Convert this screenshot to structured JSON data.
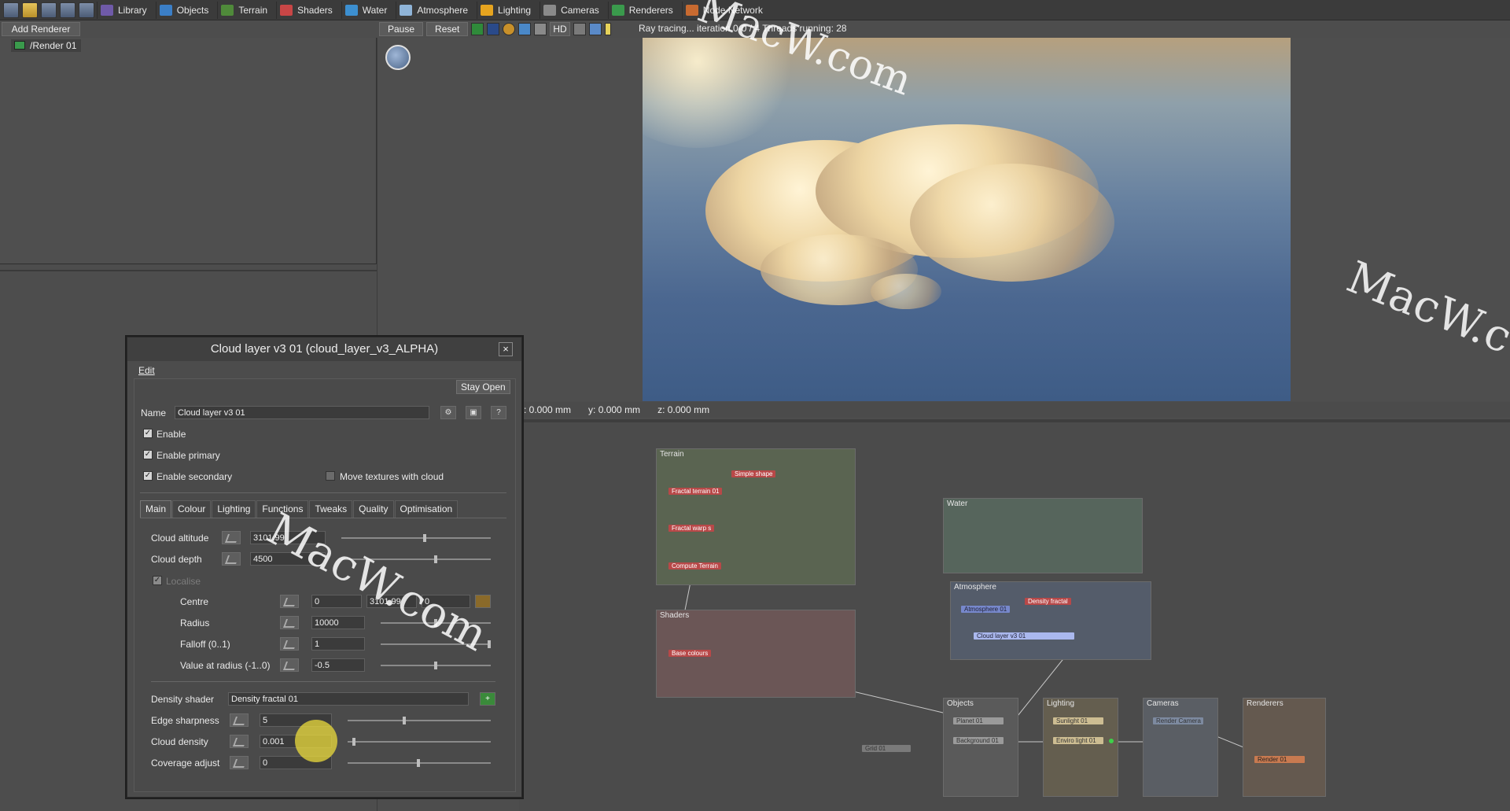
{
  "toolbar": {
    "items": [
      {
        "label": "Library",
        "icon": "library-icon",
        "color": "#6f5aa8"
      },
      {
        "label": "Objects",
        "icon": "objects-icon",
        "color": "#3b7fc7"
      },
      {
        "label": "Terrain",
        "icon": "terrain-icon",
        "color": "#4f8a3a"
      },
      {
        "label": "Shaders",
        "icon": "shaders-icon",
        "color": "#c84646"
      },
      {
        "label": "Water",
        "icon": "water-icon",
        "color": "#3c8fd0"
      },
      {
        "label": "Atmosphere",
        "icon": "atmosphere-icon",
        "color": "#8fb4d8"
      },
      {
        "label": "Lighting",
        "icon": "lighting-icon",
        "color": "#e6a41f"
      },
      {
        "label": "Cameras",
        "icon": "cameras-icon",
        "color": "#8a8a8a"
      },
      {
        "label": "Renderers",
        "icon": "renderers-icon",
        "color": "#3a9a4c"
      },
      {
        "label": "Node Network",
        "icon": "node-network-icon",
        "color": "#c86a30"
      }
    ]
  },
  "renderers": {
    "add_label": "Add Renderer",
    "item_label": "/Render 01"
  },
  "render_controls": {
    "pause_label": "Pause",
    "reset_label": "Reset",
    "hd_label": "HD",
    "status": "Ray tracing... iteration 0-0 / 4     Threads running: 28"
  },
  "coords": {
    "x": "x: 0.000 mm",
    "y": "y: 0.000 mm",
    "z": "z: 0.000 mm"
  },
  "dialog": {
    "title": "Cloud layer v3 01    (cloud_layer_v3_ALPHA)",
    "close": "×",
    "menu_edit": "Edit",
    "stay_open": "Stay Open",
    "name_label": "Name",
    "name_value": "Cloud layer v3 01",
    "enable": "Enable",
    "enable_primary": "Enable primary",
    "enable_secondary": "Enable secondary",
    "move_textures": "Move textures with cloud",
    "tabs": [
      "Main",
      "Colour",
      "Lighting",
      "Functions",
      "Tweaks",
      "Quality",
      "Optimisation"
    ],
    "cloud_altitude_label": "Cloud altitude",
    "cloud_altitude": "3101.99",
    "cloud_depth_label": "Cloud depth",
    "cloud_depth": "4500",
    "localise": "Localise",
    "centre_label": "Centre",
    "centre_x": "0",
    "centre_y": "3101.99",
    "centre_z": "0",
    "radius_label": "Radius",
    "radius": "10000",
    "falloff_label": "Falloff (0..1)",
    "falloff": "1",
    "value_at_radius_label": "Value at radius (-1..0)",
    "value_at_radius": "-0.5",
    "density_shader_label": "Density shader",
    "density_shader": "Density fractal 01",
    "edge_sharpness_label": "Edge sharpness",
    "edge_sharpness": "5",
    "cloud_density_label": "Cloud density",
    "cloud_density": "0.001",
    "coverage_adjust_label": "Coverage adjust",
    "coverage_adjust": "0"
  },
  "node_network": {
    "groups": {
      "terrain": "Terrain",
      "shaders": "Shaders",
      "water": "Water",
      "atmosphere": "Atmosphere",
      "objects": "Objects",
      "lighting": "Lighting",
      "cameras": "Cameras",
      "renderers": "Renderers"
    },
    "nodes": {
      "simple_shape": "Simple shape",
      "fractal_terrain": "Fractal terrain 01",
      "fractal_warp": "Fractal warp s",
      "compute_terrain": "Compute Terrain",
      "base_colours": "Base colours",
      "atmosphere_01": "Atmosphere 01",
      "density_fractal": "Density fractal",
      "cloud_layer": "Cloud layer v3 01",
      "planet": "Planet 01",
      "background": "Background 01",
      "sunlight": "Sunlight 01",
      "enviro_light": "Enviro light 01",
      "render_camera": "Render Camera",
      "render_01": "Render 01",
      "grid": "Grid 01"
    }
  },
  "watermarks": [
    "MacW.com",
    "MacW.com",
    "MacW.c"
  ]
}
